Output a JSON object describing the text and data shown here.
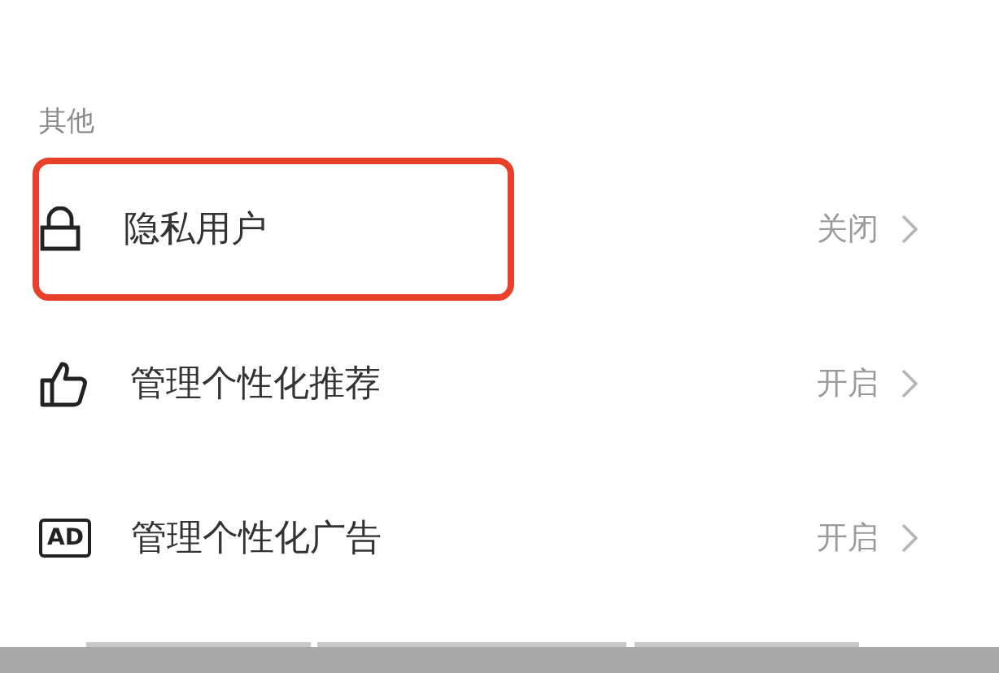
{
  "section": {
    "title": "其他"
  },
  "items": [
    {
      "kind": "lock",
      "label": "隐私用户",
      "value": "关闭",
      "highlighted": true
    },
    {
      "kind": "thumb",
      "label": "管理个性化推荐",
      "value": "开启",
      "highlighted": false
    },
    {
      "kind": "ad",
      "icon_text": "AD",
      "label": "管理个性化广告",
      "value": "开启",
      "highlighted": false
    }
  ]
}
